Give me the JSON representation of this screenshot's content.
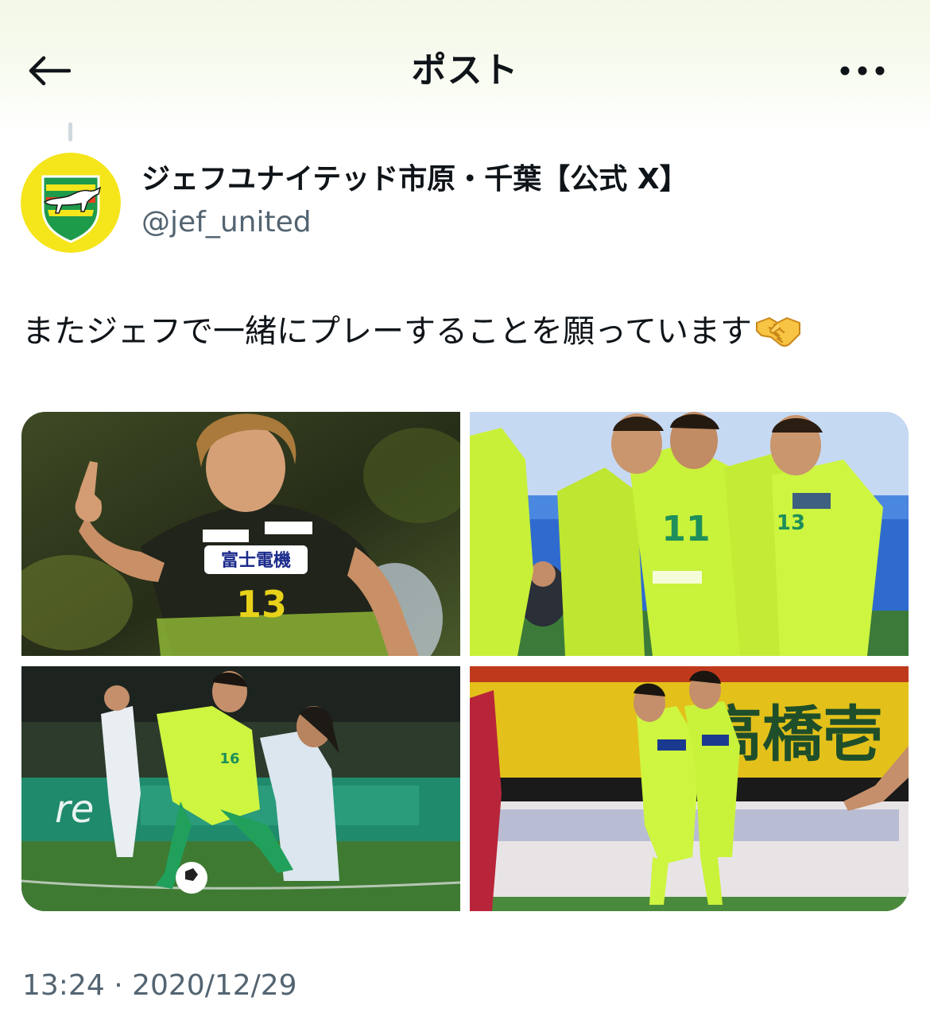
{
  "header": {
    "title": "ポスト",
    "back_icon": "arrow-left-icon",
    "more_icon": "more-horizontal-icon"
  },
  "author": {
    "display_name": "ジェフユナイテッド市原・千葉【公式 X】",
    "handle": "@jef_united",
    "avatar_icon": "club-crest-logo"
  },
  "post": {
    "text": "またジェフで一緒にプレーすることを願っています",
    "emoji": "handshake-emoji",
    "timestamp": "13:24 · 2020/12/29"
  },
  "media": {
    "count": 4,
    "photos": [
      {
        "alt": "photo-player-13-pointing"
      },
      {
        "alt": "photo-team-celebration"
      },
      {
        "alt": "photo-player-16-dribbling"
      },
      {
        "alt": "photo-two-players-celebrating"
      }
    ]
  },
  "colors": {
    "text_primary": "#0f1419",
    "text_secondary": "#536471",
    "club_yellow": "#f5e51b",
    "club_green": "#1e9a4b",
    "kit_lime": "#c9f23a"
  },
  "photo_texts": {
    "p1_shirt_number": "13",
    "p1_sponsor": "富士電機",
    "p3_shirt_number": "16",
    "p4_banner": "高橋壱"
  }
}
